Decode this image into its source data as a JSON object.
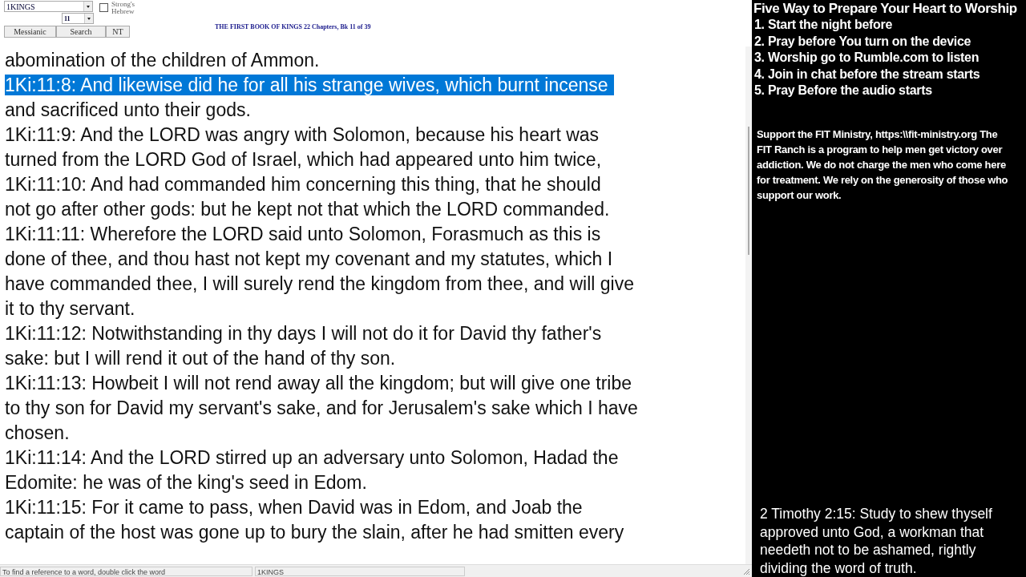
{
  "toolbar": {
    "book_select": {
      "value": "1KINGS"
    },
    "strongs_checkbox": {
      "label": "Strong's Hebrew",
      "checked": false
    },
    "chapter_select": {
      "value": "11"
    },
    "buttons": [
      "Messianic",
      "Search",
      "NT"
    ],
    "book_title": "THE FIRST BOOK OF KINGS 22 Chapters, Bk 11 of 39"
  },
  "text_lines": [
    {
      "text": "abomination of the children of Ammon.",
      "selected": false
    },
    {
      "text": "1Ki:11:8: And likewise did he for all his strange wives, which burnt incense",
      "selected": true
    },
    {
      "text": "and sacrificed unto their gods.",
      "selected": false
    },
    {
      "text": "1Ki:11:9: And the LORD was angry with Solomon, because his heart was",
      "selected": false
    },
    {
      "text": "turned from the LORD God of Israel, which had appeared unto him twice,",
      "selected": false
    },
    {
      "text": "1Ki:11:10: And had commanded him concerning this thing, that he should",
      "selected": false
    },
    {
      "text": "not go after other gods: but he kept not that which the LORD commanded.",
      "selected": false
    },
    {
      "text": "1Ki:11:11: Wherefore the LORD said unto Solomon, Forasmuch as this is",
      "selected": false
    },
    {
      "text": "done of thee, and thou hast not kept my covenant and my statutes, which I",
      "selected": false
    },
    {
      "text": "have commanded thee, I will surely rend the kingdom from thee, and will give",
      "selected": false
    },
    {
      "text": "it to thy servant.",
      "selected": false
    },
    {
      "text": "1Ki:11:12: Notwithstanding in thy days I will not do it for David thy father's",
      "selected": false
    },
    {
      "text": "sake: but I will rend it out of the hand of thy son.",
      "selected": false
    },
    {
      "text": "1Ki:11:13: Howbeit I will not rend away all the kingdom; but will give one tribe",
      "selected": false
    },
    {
      "text": "to thy son for David my servant's sake, and for Jerusalem's sake which I have",
      "selected": false
    },
    {
      "text": "chosen.",
      "selected": false
    },
    {
      "text": "1Ki:11:14: And the LORD stirred up an adversary unto Solomon, Hadad the",
      "selected": false
    },
    {
      "text": "Edomite: he was of the king's seed in Edom.",
      "selected": false
    },
    {
      "text": "1Ki:11:15: For it came to pass, when David was in Edom, and Joab the",
      "selected": false
    },
    {
      "text": "captain of the host was gone up to bury the slain, after he had smitten every",
      "selected": false
    }
  ],
  "status_bar": [
    "To find a reference to a word, double click the word",
    "1KINGS"
  ],
  "overlay": {
    "heading": "Five Way to Prepare Your Heart to Worship",
    "steps": [
      "1. Start the night before",
      "2. Pray before You turn on the device",
      "3. Worship go to Rumble.com to listen",
      "4. Join in chat before the stream starts",
      "5. Pray Before the audio starts"
    ],
    "support": "Support the FIT Ministry, https:\\\\fit-ministry.org The FIT Ranch is a program to help men get victory over addiction. We do not charge the men who come here for treatment. We rely on the generosity of those who support our work.",
    "verse": "2 Timothy 2:15: Study to shew thyself approved unto God, a workman that needeth not to be ashamed, rightly dividing the word of truth."
  }
}
